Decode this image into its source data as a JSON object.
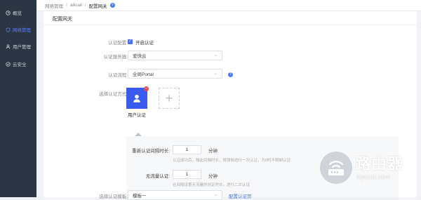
{
  "sidebar": {
    "items": [
      {
        "label": "概览",
        "icon": "clock-icon"
      },
      {
        "label": "网络管理",
        "icon": "shield-icon",
        "active": true
      },
      {
        "label": "用户管理",
        "icon": "user-icon"
      },
      {
        "label": "云安全",
        "icon": "cloud-shield-icon"
      }
    ]
  },
  "breadcrumb": [
    "网络管理",
    "aikual",
    "配置网关"
  ],
  "panel": {
    "title": "配置网关",
    "auth_config": {
      "label": "认证配置:",
      "checkbox_text": "开启认证",
      "checked": true
    },
    "auth_server": {
      "label": "认证服务器:",
      "value": "爱快云"
    },
    "auth_flow": {
      "label": "认证流程:",
      "value": "全局Portal"
    },
    "auth_method": {
      "label": "选择认证方式:",
      "card_label": "用户认证"
    },
    "reauth": {
      "label": "重新认证间隔时长:",
      "value": "1",
      "unit": "分钟",
      "hint": "认证成功后，隔此间隔时长，将强制进行一次认证，为0时不限制认证"
    },
    "no_traffic": {
      "label": "无流量认证:",
      "value": "1",
      "unit": "分钟",
      "hint": "在间隔设置无流量的则定时长，进行二次认证"
    },
    "template": {
      "label": "选择认证模板:",
      "value": "模板一",
      "link": "配置认证页"
    }
  },
  "colors": {
    "accent": "#3a5bf0",
    "sidebar_bg": "#2b3544",
    "danger": "#e5484d"
  },
  "watermark": {
    "title": "路由器",
    "url": "luyouqi.com"
  }
}
